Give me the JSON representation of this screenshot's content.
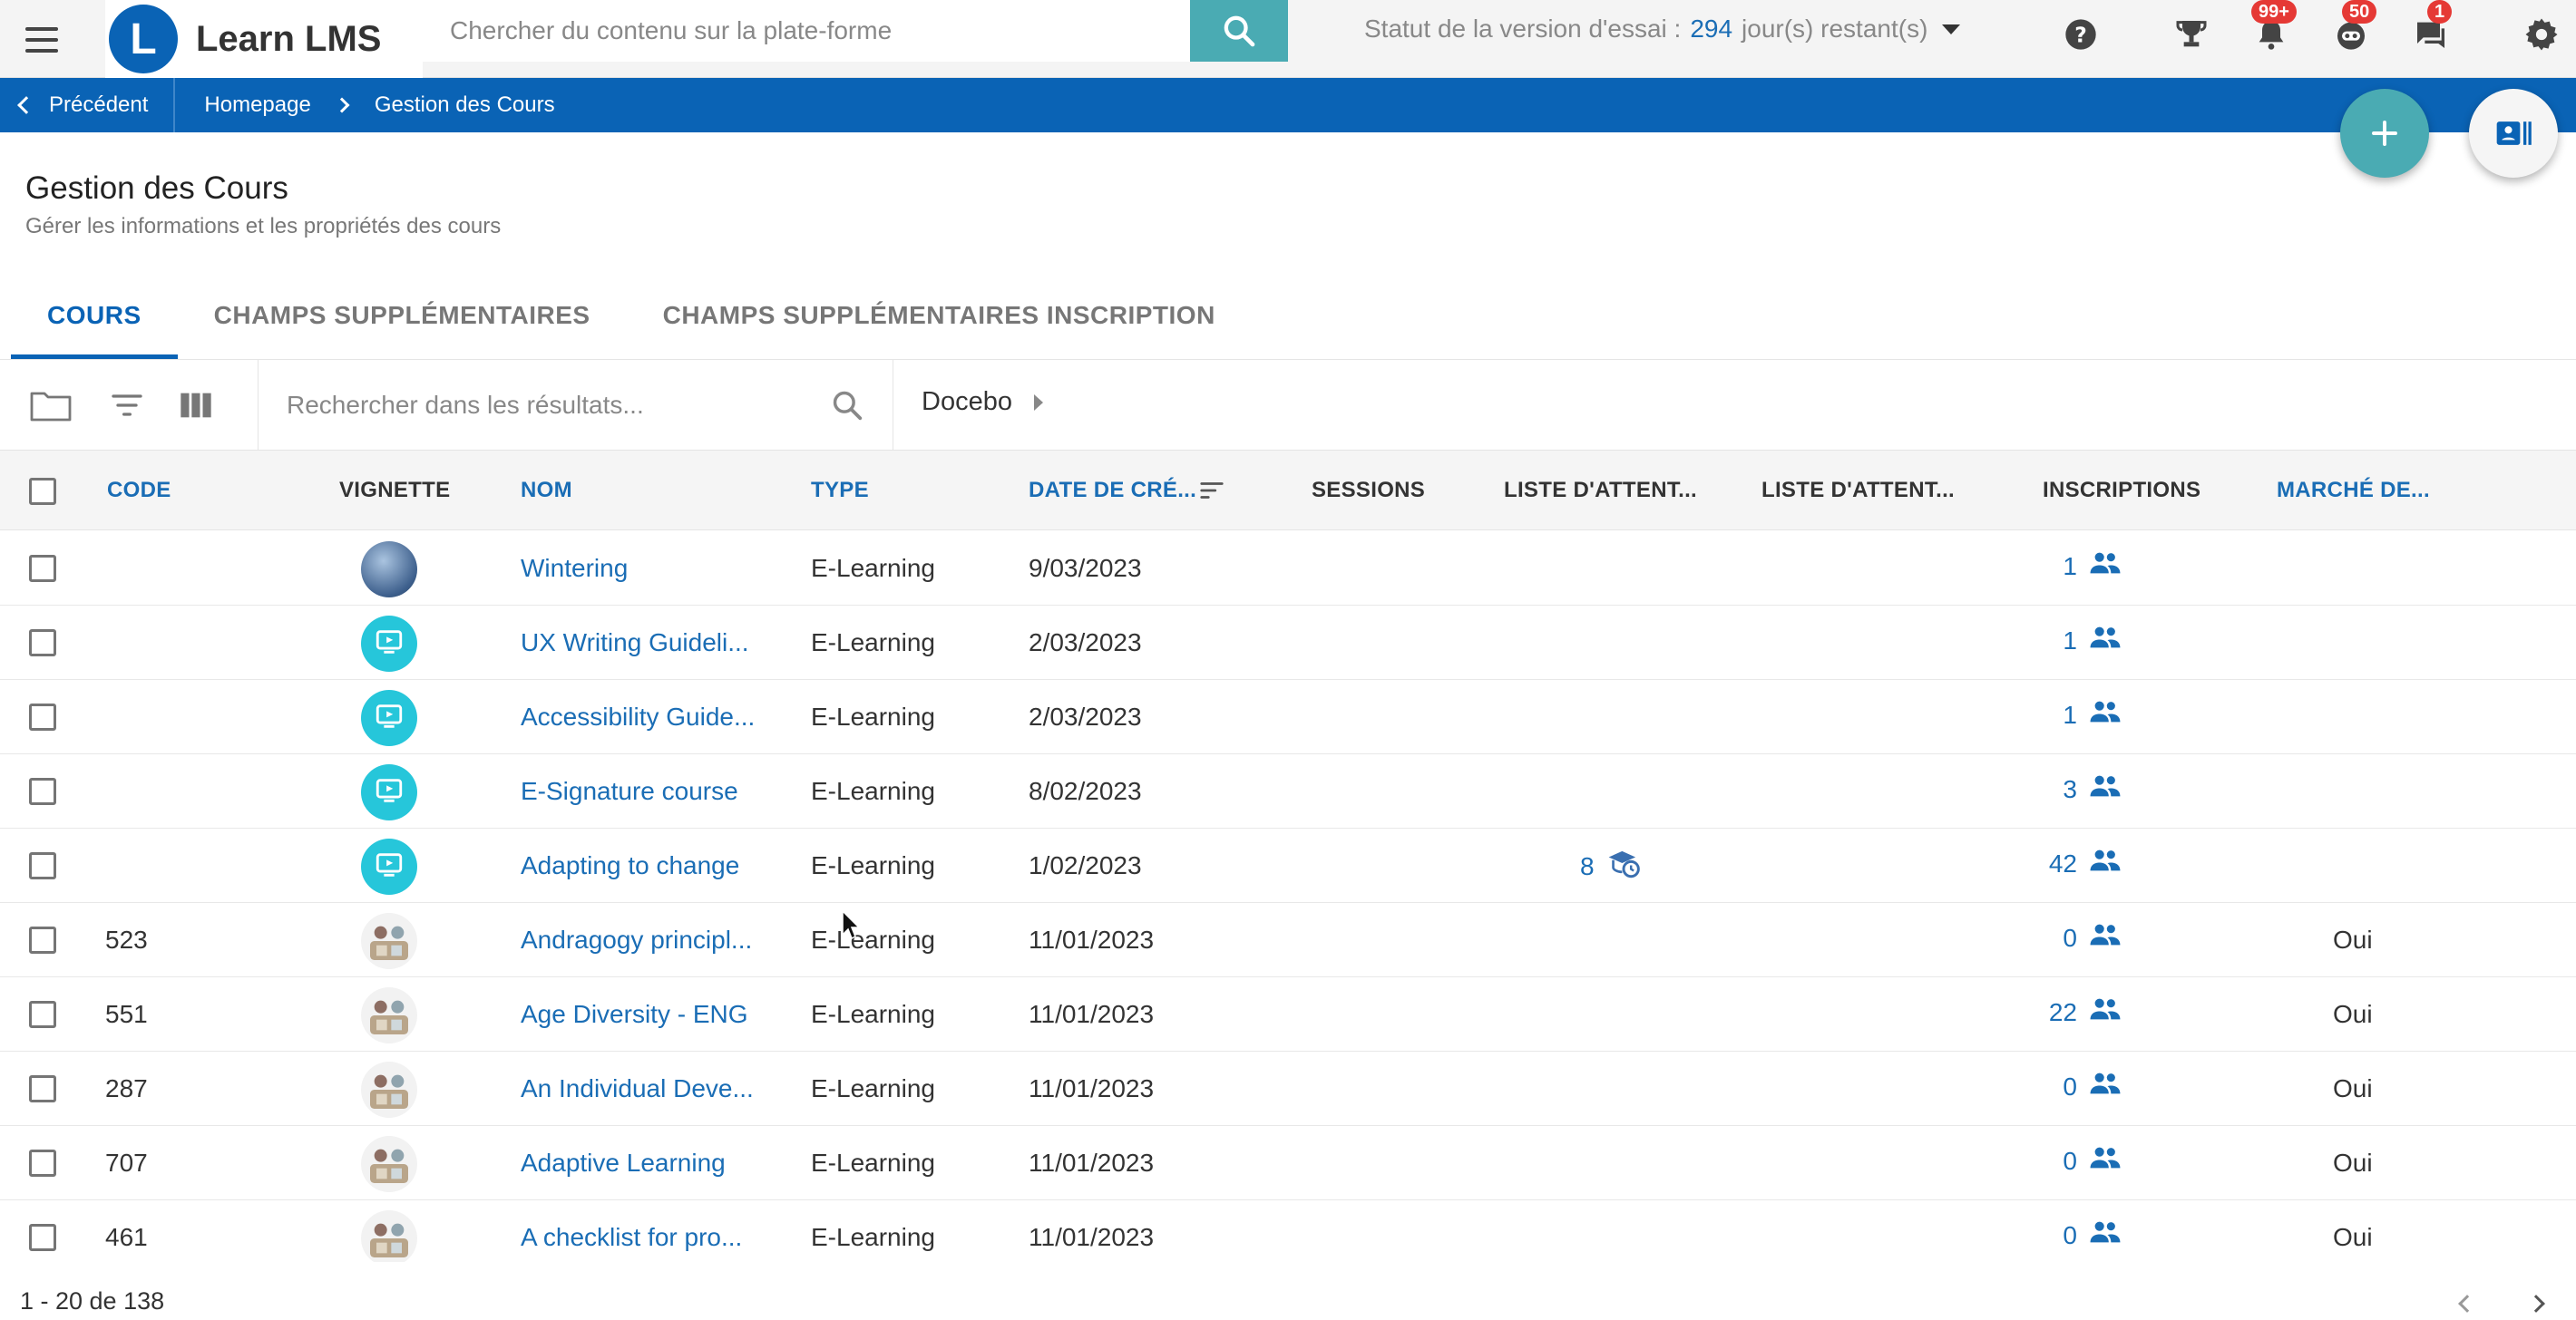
{
  "app": {
    "logo_letter": "L",
    "name": "Learn LMS",
    "global_search_placeholder": "Chercher du contenu sur la plate-forme",
    "trial_prefix": "Statut de la version d'essai : ",
    "trial_days": "294",
    "trial_suffix": " jour(s) restant(s)",
    "badges": {
      "notifications": "99+",
      "bot": "50",
      "messages": "1"
    },
    "colors": {
      "primary": "#0a63b5",
      "teal": "#4aabb3",
      "badge": "#e53935"
    }
  },
  "breadcrumb": {
    "back_label": "Précédent",
    "items": [
      "Homepage",
      "Gestion des Cours"
    ]
  },
  "page": {
    "title": "Gestion des Cours",
    "subtitle": "Gérer les informations et les propriétés des cours"
  },
  "tabs": [
    {
      "label": "COURS",
      "active": true
    },
    {
      "label": "CHAMPS SUPPLÉMENTAIRES",
      "active": false
    },
    {
      "label": "CHAMPS SUPPLÉMENTAIRES INSCRIPTION",
      "active": false
    }
  ],
  "toolbar": {
    "results_search_placeholder": "Rechercher dans les résultats...",
    "branch_label": "Docebo"
  },
  "table": {
    "columns": [
      "CODE",
      "VIGNETTE",
      "NOM",
      "TYPE",
      "DATE DE CRÉ...",
      "SESSIONS",
      "LISTE D'ATTENT...",
      "LISTE D'ATTENT...",
      "INSCRIPTIONS",
      "MARCHÉ DE..."
    ],
    "rows": [
      {
        "code": "",
        "thumb": "globe",
        "name": "Wintering",
        "type": "E-Learning",
        "date": "9/03/2023",
        "waitlist": "",
        "enrollments": "1",
        "marketplace": ""
      },
      {
        "code": "",
        "thumb": "teal",
        "name": "UX Writing Guideli...",
        "type": "E-Learning",
        "date": "2/03/2023",
        "waitlist": "",
        "enrollments": "1",
        "marketplace": ""
      },
      {
        "code": "",
        "thumb": "teal",
        "name": "Accessibility Guide...",
        "type": "E-Learning",
        "date": "2/03/2023",
        "waitlist": "",
        "enrollments": "1",
        "marketplace": ""
      },
      {
        "code": "",
        "thumb": "teal",
        "name": "E-Signature course",
        "type": "E-Learning",
        "date": "8/02/2023",
        "waitlist": "",
        "enrollments": "3",
        "marketplace": ""
      },
      {
        "code": "",
        "thumb": "teal",
        "name": "Adapting to change",
        "type": "E-Learning",
        "date": "1/02/2023",
        "waitlist": "8",
        "enrollments": "42",
        "marketplace": ""
      },
      {
        "code": "523",
        "thumb": "photo",
        "name": "Andragogy principl...",
        "type": "E-Learning",
        "date": "11/01/2023",
        "waitlist": "",
        "enrollments": "0",
        "marketplace": "Oui"
      },
      {
        "code": "551",
        "thumb": "photo",
        "name": "Age Diversity - ENG",
        "type": "E-Learning",
        "date": "11/01/2023",
        "waitlist": "",
        "enrollments": "22",
        "marketplace": "Oui"
      },
      {
        "code": "287",
        "thumb": "photo",
        "name": "An Individual Deve...",
        "type": "E-Learning",
        "date": "11/01/2023",
        "waitlist": "",
        "enrollments": "0",
        "marketplace": "Oui"
      },
      {
        "code": "707",
        "thumb": "photo",
        "name": "Adaptive Learning",
        "type": "E-Learning",
        "date": "11/01/2023",
        "waitlist": "",
        "enrollments": "0",
        "marketplace": "Oui"
      },
      {
        "code": "461",
        "thumb": "photo",
        "name": "A checklist for pro...",
        "type": "E-Learning",
        "date": "11/01/2023",
        "waitlist": "",
        "enrollments": "0",
        "marketplace": "Oui"
      }
    ]
  },
  "pagination": {
    "label": "1 - 20 de 138"
  }
}
